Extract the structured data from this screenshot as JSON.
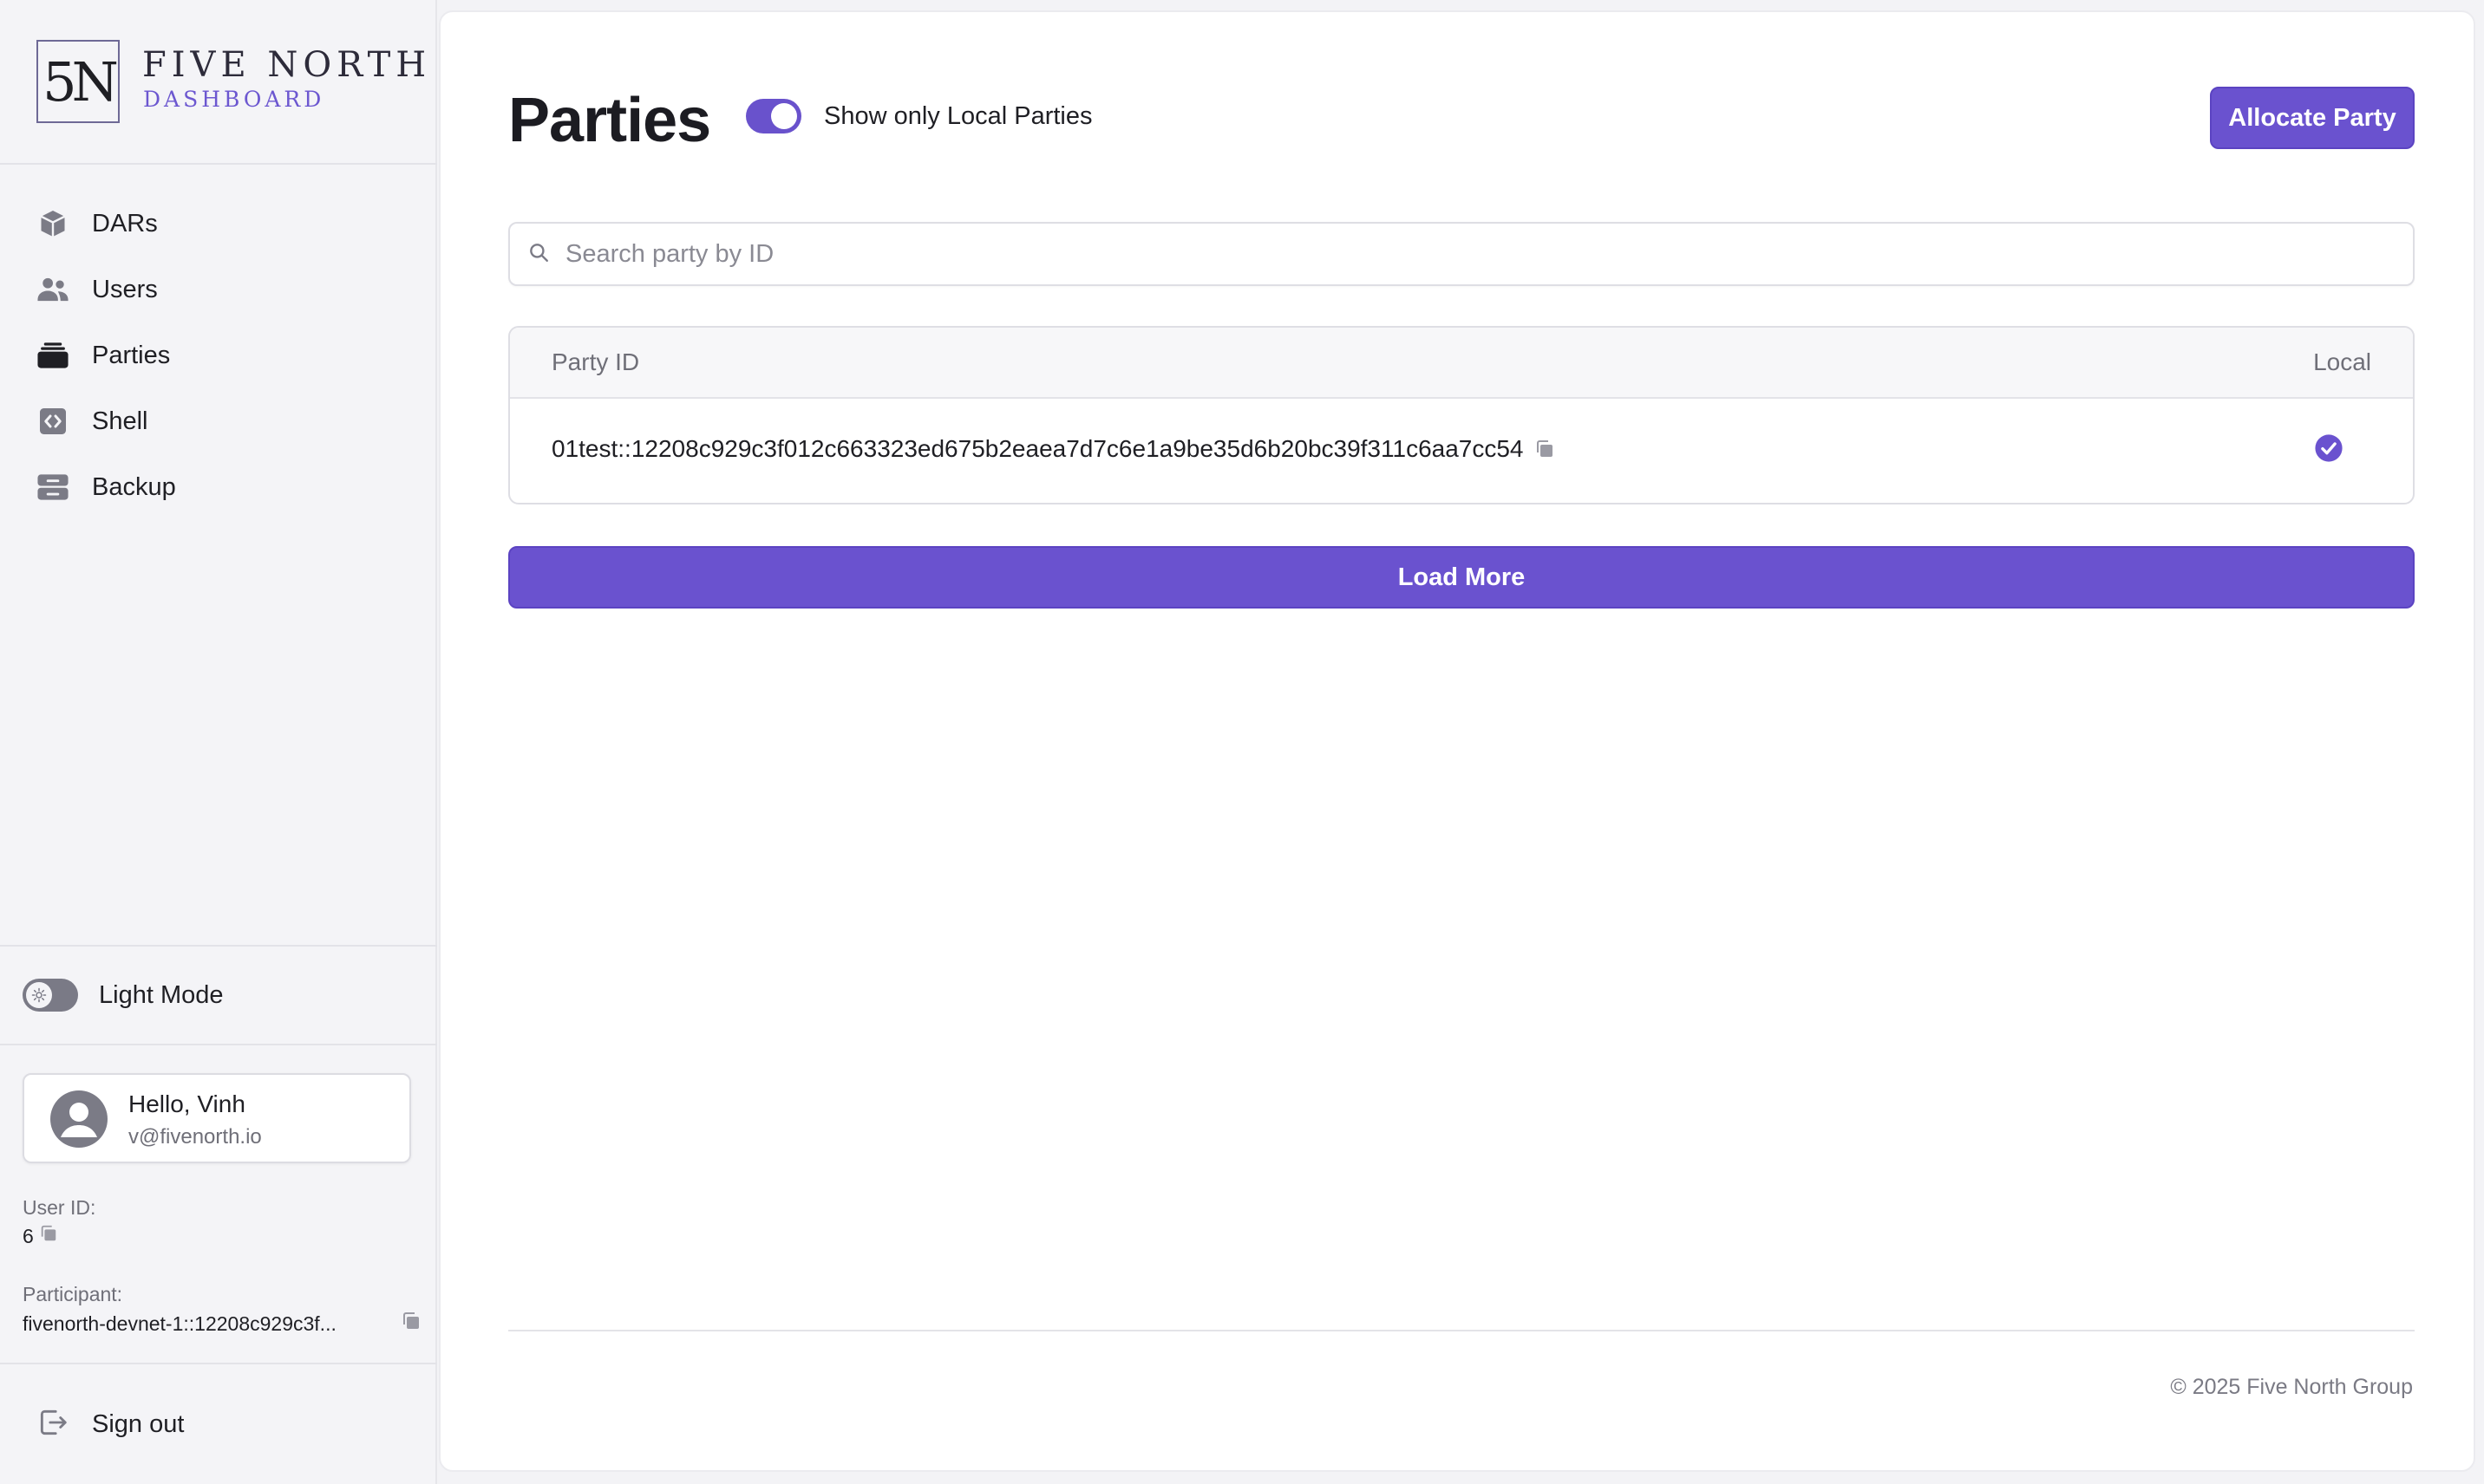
{
  "brand": {
    "mark": "5N",
    "name": "FIVE NORTH",
    "subtitle": "DASHBOARD"
  },
  "sidebar": {
    "items": [
      {
        "label": "DARs",
        "icon": "cube-icon"
      },
      {
        "label": "Users",
        "icon": "users-icon"
      },
      {
        "label": "Parties",
        "icon": "stack-icon"
      },
      {
        "label": "Shell",
        "icon": "code-icon"
      },
      {
        "label": "Backup",
        "icon": "archive-icon"
      }
    ],
    "mode_label": "Light Mode",
    "user": {
      "greeting": "Hello, Vinh",
      "email": "v@fivenorth.io"
    },
    "user_id_label": "User ID:",
    "user_id_value": "6",
    "participant_label": "Participant:",
    "participant_value": "fivenorth-devnet-1::12208c929c3f...",
    "sign_out": "Sign out"
  },
  "main": {
    "title": "Parties",
    "local_toggle_label": "Show only Local Parties",
    "local_toggle_on": true,
    "allocate_button": "Allocate Party",
    "search": {
      "placeholder": "Search party by ID",
      "value": ""
    },
    "table": {
      "headers": [
        "Party ID",
        "Local"
      ],
      "rows": [
        {
          "party_id": "01test::12208c929c3f012c663323ed675b2eaea7d7c6e1a9be35d6b20bc39f311c6aa7cc54",
          "local": true
        }
      ]
    },
    "load_more": "Load More",
    "footer": "© 2025 Five North Group"
  },
  "colors": {
    "accent": "#6a52cf",
    "sidebar_bg": "#f4f4f7",
    "panel_bg": "#ffffff",
    "muted_text": "#6f6f78"
  }
}
